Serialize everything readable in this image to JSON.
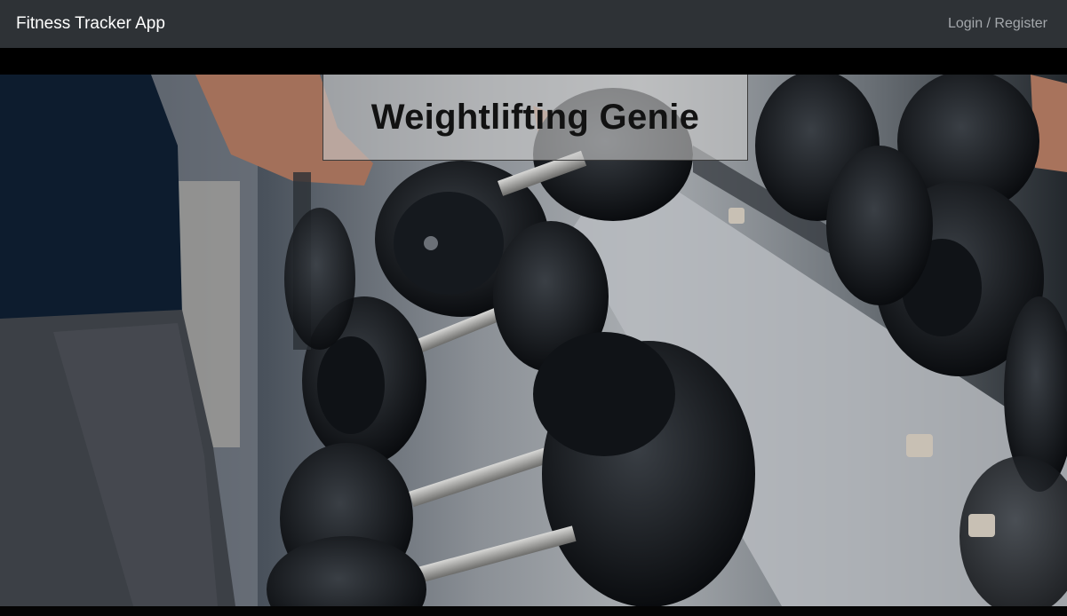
{
  "navbar": {
    "brand": "Fitness Tracker App",
    "auth_link": "Login / Register",
    "background": "#2e3236"
  },
  "hero": {
    "title": "Weightlifting Genie",
    "image_description": "gym dumbbell rack"
  }
}
